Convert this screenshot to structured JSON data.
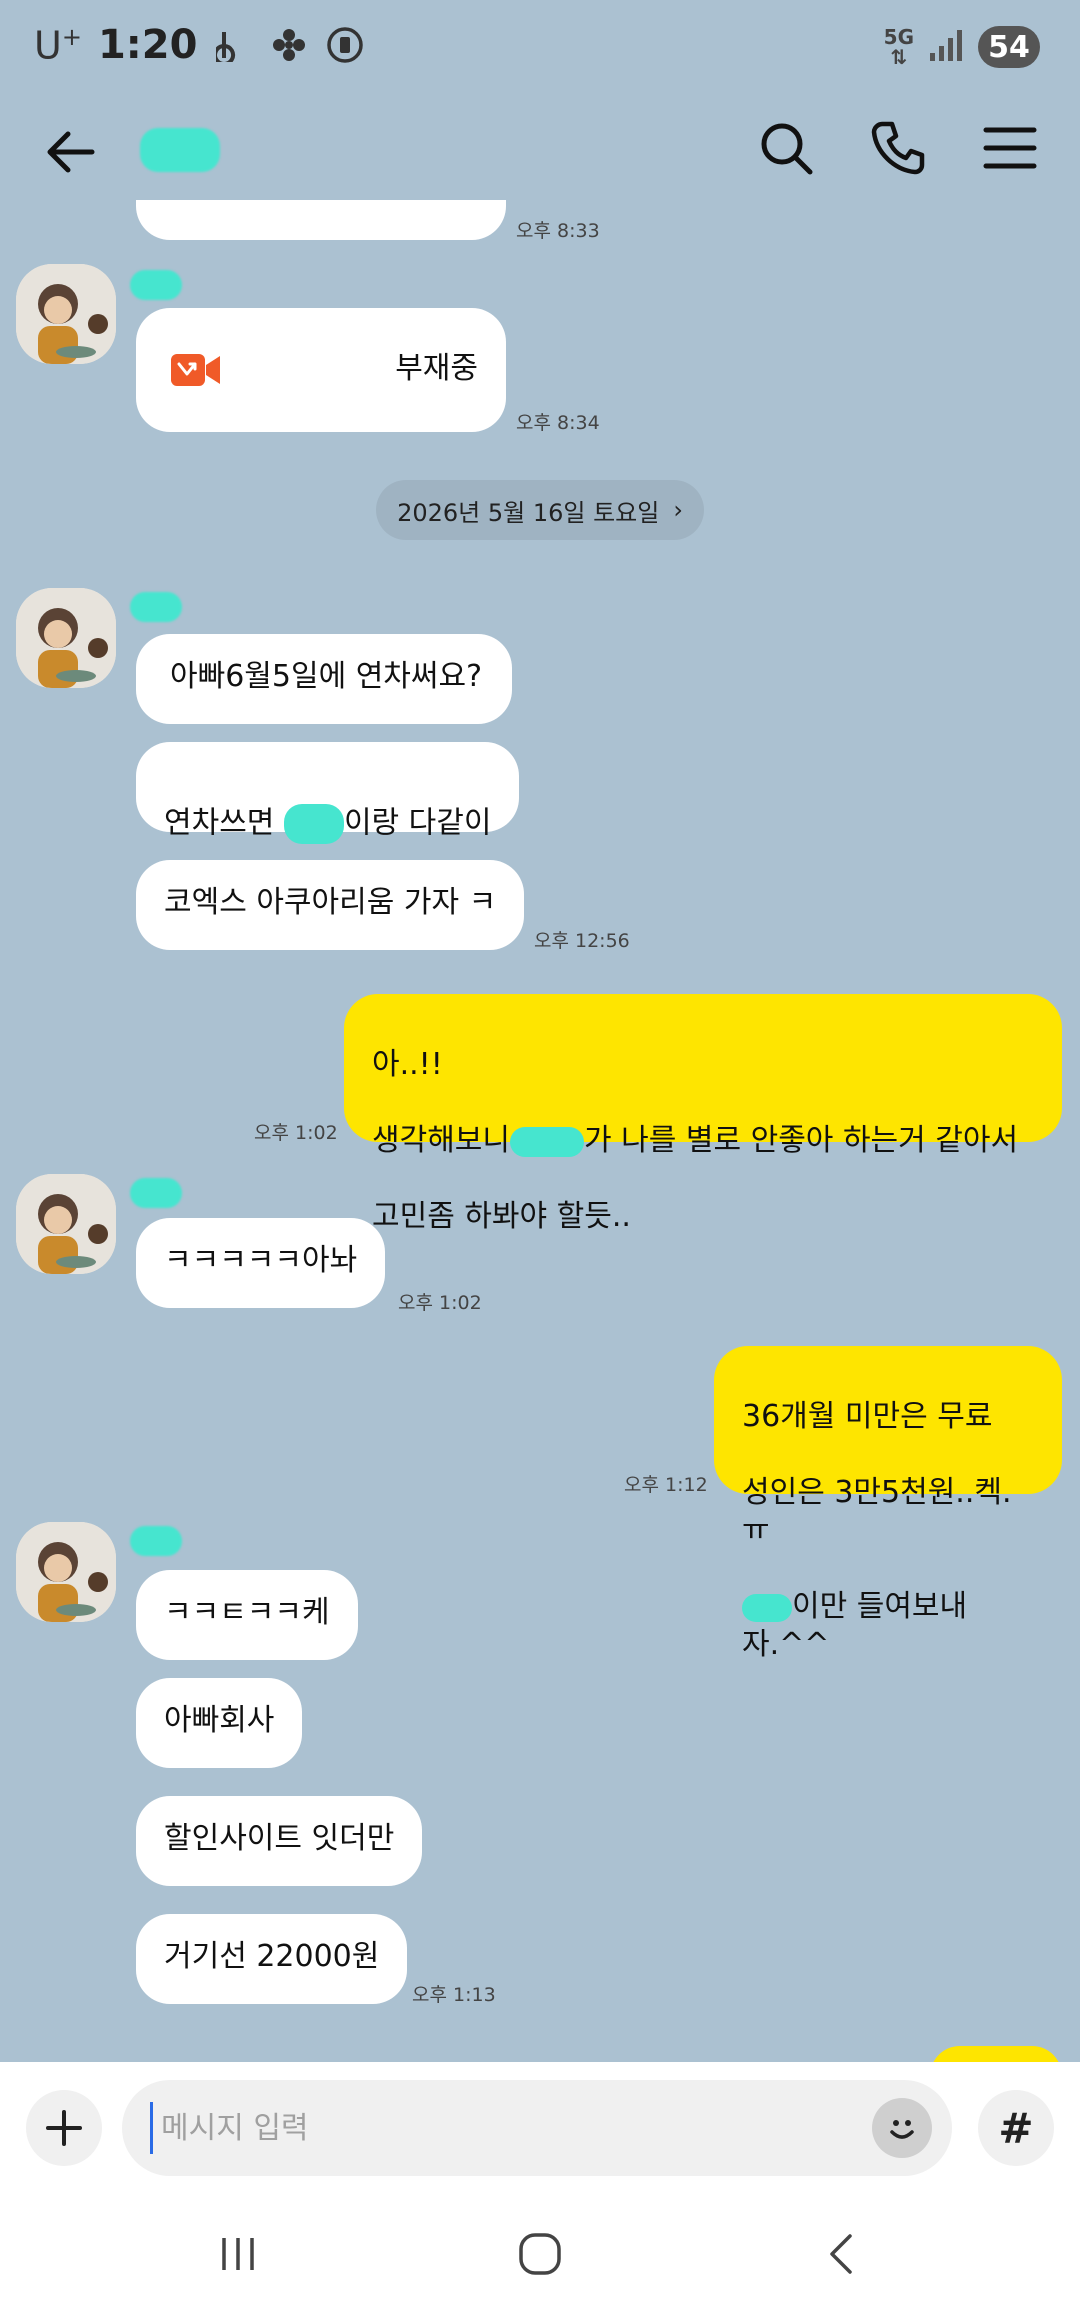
{
  "status_bar": {
    "carrier": "U",
    "carrier_sup": "+",
    "time": "1:20",
    "network": "5G",
    "battery": "54"
  },
  "header": {
    "title_redacted": true,
    "icons": [
      "back-arrow-icon",
      "search-icon",
      "call-icon",
      "menu-icon"
    ]
  },
  "messages": {
    "m0_time": "오후 8:33",
    "call_label": "부재중",
    "call_time": "오후 8:34",
    "date_divider": "2026년 5월 16일 토요일",
    "in1": "아빠6월5일에 연차써요?",
    "in2_a": "연차쓰면 ",
    "in2_b": "이랑 다같이",
    "in3": "코엑스 아쿠아리움 가자 ㅋ",
    "in3_time": "오후 12:56",
    "out1_line1": "아..!!",
    "out1_line2a": "생각해보니",
    "out1_line2b": "가 나를 별로 안좋아 하는거 같아서",
    "out1_line3": "고민좀 하봐야 할듯..",
    "out1_time": "오후 1:02",
    "in4": "ㅋㅋㅋㅋㅋ아놔",
    "in4_time": "오후 1:02",
    "out2_line1": "36개월 미만은 무료",
    "out2_line2": "성인은 3만5천원..켁.ㅠ",
    "out2_line3": "이만 들여보내자.^^",
    "out2_time": "오후 1:12",
    "in5": "ㅋㅋㅌㅋㅋ케",
    "in6": "아빠회사",
    "in7": "할인사이트 잇더만",
    "in8": "거기선 22000원",
    "in8_time": "오후 1:13"
  },
  "composer": {
    "placeholder": "메시지 입력",
    "hash_label": "#"
  },
  "colors": {
    "chat_bg": "#abc1d1",
    "my_bubble": "#fee500",
    "their_bubble": "#ffffff",
    "missed_call": "#f05a28"
  }
}
